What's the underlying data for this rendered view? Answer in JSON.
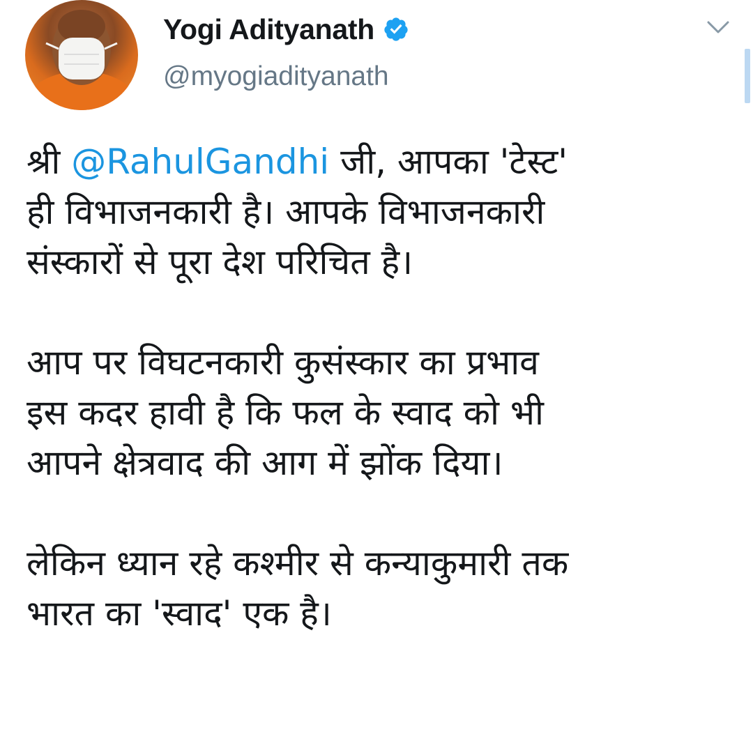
{
  "tweet": {
    "author": {
      "display_name": "Yogi Adityanath",
      "handle": "@myogiadityanath",
      "verified": true,
      "avatar_icon": "profile-photo-masked-person"
    },
    "icons": {
      "verified": "verified-badge-icon",
      "caret": "chevron-down-icon"
    },
    "colors": {
      "link": "#1b95e0",
      "text": "#14171a",
      "secondary": "#657786",
      "verified": "#1da1f2"
    },
    "body": {
      "p1": {
        "prefix": "श्री ",
        "mention": "@RahulGandhi",
        "line1_suffix": " जी, आपका 'टेस्ट'",
        "line2": "ही विभाजनकारी है। आपके विभाजनकारी",
        "line3": "संस्कारों से पूरा देश परिचित है।"
      },
      "p2": {
        "line1": "आप पर विघटनकारी कुसंस्कार का प्रभाव",
        "line2": "इस कदर हावी है कि फल के स्वाद को भी",
        "line3": "आपने क्षेत्रवाद की आग में झोंक दिया।"
      },
      "p3": {
        "line1": "लेकिन ध्यान रहे कश्मीर से कन्याकुमारी तक",
        "line2": "भारत का 'स्वाद' एक है।"
      }
    }
  }
}
